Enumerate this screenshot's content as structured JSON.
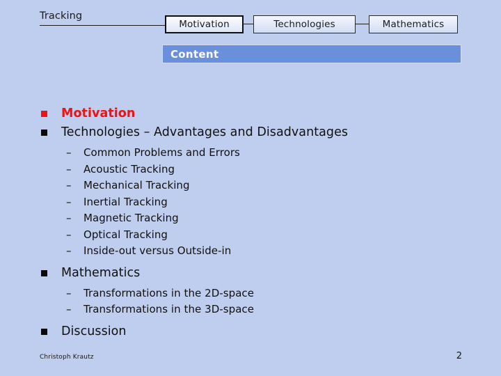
{
  "slide": {
    "background_color": "#bfcdee",
    "accent_color": "#ee1212",
    "banner_color": "#6a8fdb"
  },
  "tracker": {
    "title": "Tracking",
    "items": [
      {
        "label": "Motivation",
        "active": true
      },
      {
        "label": "Technologies",
        "active": false
      },
      {
        "label": "Mathematics",
        "active": false
      }
    ]
  },
  "banner": {
    "title": "Content"
  },
  "outline": [
    {
      "label": "Motivation",
      "accent": true,
      "children": []
    },
    {
      "label": "Technologies – Advantages and Disadvantages",
      "accent": false,
      "children": [
        "Common Problems and Errors",
        "Acoustic Tracking",
        "Mechanical Tracking",
        "Inertial Tracking",
        "Magnetic Tracking",
        "Optical Tracking",
        "Inside-out versus Outside-in"
      ]
    },
    {
      "label": "Mathematics",
      "accent": false,
      "children": [
        "Transformations in the 2D-space",
        "Transformations in the 3D-space"
      ]
    },
    {
      "label": "Discussion",
      "accent": false,
      "children": []
    }
  ],
  "bullets": {
    "level1_marker": "square",
    "level2_marker": "–"
  },
  "footer": {
    "author": "Christoph Krautz",
    "page_number": "2"
  }
}
